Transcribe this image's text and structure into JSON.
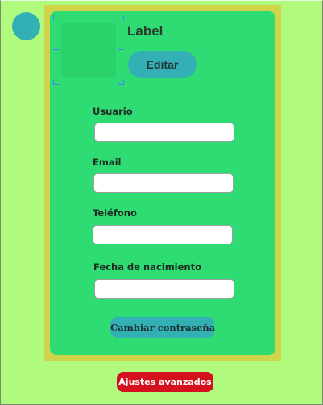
{
  "profile": {
    "label": "Label",
    "edit_button": "Editar"
  },
  "form": {
    "fields": [
      {
        "label": "Usuario",
        "value": ""
      },
      {
        "label": "Email",
        "value": ""
      },
      {
        "label": "Teléfono",
        "value": ""
      },
      {
        "label": "Fecha de nacimiento",
        "value": ""
      }
    ],
    "change_password_button": "Cambiar contraseña"
  },
  "footer": {
    "advanced_settings_button": "Ajustes avanzados"
  },
  "colors": {
    "background": "#b0fa7e",
    "card": "#2fdc74",
    "frame": "#cfd44a",
    "accent": "#33b0b3",
    "danger": "#d4101e"
  }
}
